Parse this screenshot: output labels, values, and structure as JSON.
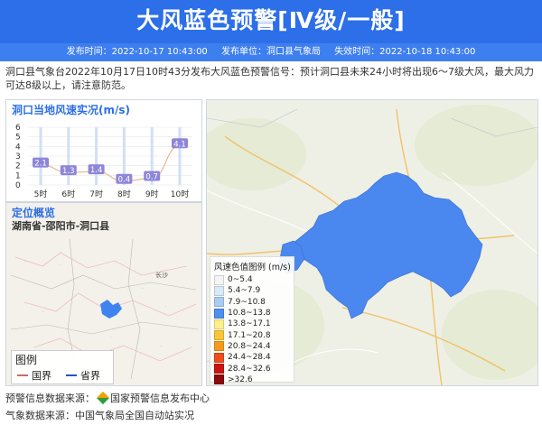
{
  "header": {
    "title": "大风蓝色预警[Ⅳ级/一般]",
    "issue_time": "发布时间：2022-10-17 10:43:00",
    "issuer": "发布单位：洞口县气象局",
    "expire_time": "失效时间：2022-10-18 10:43:00"
  },
  "summary": "洞口县气象台2022年10月17日10时43分发布大风蓝色预警信号：预计洞口县未来24小时将出现6～7级大风，最大风力可达8级以上，请注意防范。",
  "chart_panel": {
    "title": "洞口当地风速实况(m/s)"
  },
  "chart_data": {
    "type": "line",
    "title": "洞口当地风速实况(m/s)",
    "categories": [
      "5时",
      "6时",
      "7时",
      "8时",
      "9时",
      "10时"
    ],
    "values": [
      2.1,
      1.3,
      1.4,
      0.4,
      0.7,
      4.1
    ],
    "yticks": [
      "0",
      "1",
      "2",
      "3",
      "4",
      "5",
      "6"
    ],
    "ylim": [
      0,
      6
    ],
    "grid": true
  },
  "location": {
    "title": "定位概览",
    "text": "湖南省-邵阳市-洞口县",
    "map_labels": {
      "changsha": "长沙"
    },
    "legend_title": "图例",
    "legend_country": "国界",
    "legend_province": "省界"
  },
  "wind_legend": {
    "title": "风速色值图例 (m/s)",
    "items": [
      {
        "label": "0~5.4",
        "color": "#f4f4f4"
      },
      {
        "label": "5.4~7.9",
        "color": "#d8eaf8"
      },
      {
        "label": "7.9~10.8",
        "color": "#a7cef2"
      },
      {
        "label": "10.8~13.8",
        "color": "#4d8ff0"
      },
      {
        "label": "13.8~17.1",
        "color": "#fff08a"
      },
      {
        "label": "17.1~20.8",
        "color": "#f9c63a"
      },
      {
        "label": "20.8~24.4",
        "color": "#f59a1d"
      },
      {
        "label": "24.4~28.4",
        "color": "#ec4e1c"
      },
      {
        "label": "28.4~32.6",
        "color": "#c8160f"
      },
      {
        "label": ">32.6",
        "color": "#8b0a0a"
      }
    ]
  },
  "footer": {
    "warning_source_label": "预警信息数据来源：",
    "warning_source_name": "国家预警信息发布中心",
    "weather_source": "气象数据来源：中国气象局全国自动站实况"
  }
}
